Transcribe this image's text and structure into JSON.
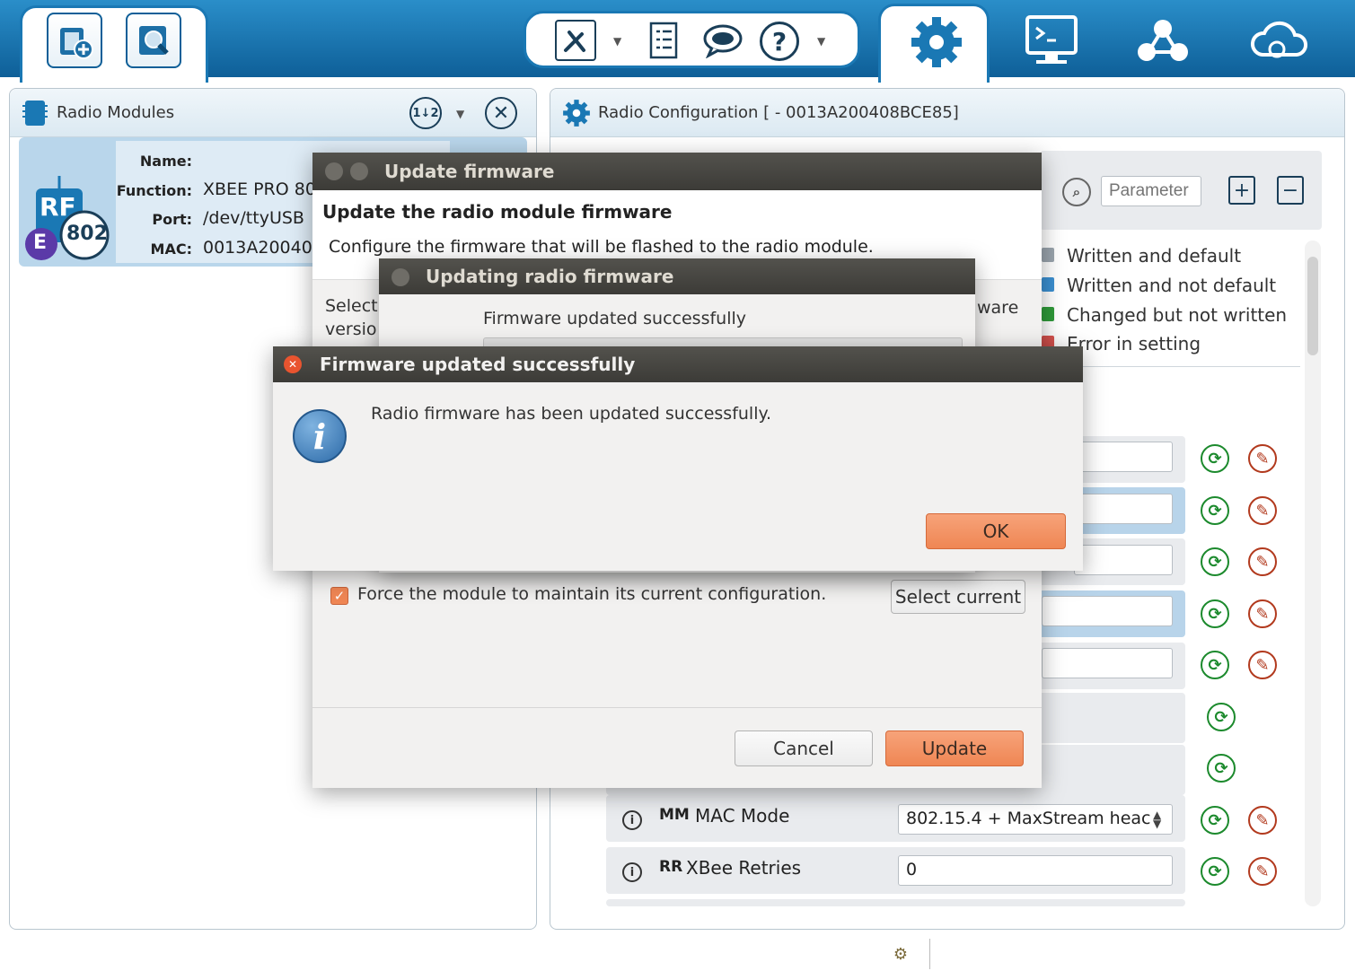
{
  "toolbar": {
    "left_buttons": [
      "add-module-icon",
      "discover-modules-icon"
    ],
    "center_icons": [
      "tools-icon",
      "console-list-icon",
      "chat-icon",
      "help-icon"
    ],
    "mode_tabs": [
      "configuration-gear-icon",
      "console-monitor-icon",
      "network-icon",
      "cloud-gear-icon"
    ]
  },
  "radio_modules": {
    "title": "Radio Modules",
    "module": {
      "name_label": "Name:",
      "function_label": "Function:",
      "function_value": "XBEE PRO 80",
      "port_label": "Port:",
      "port_value": "/dev/ttyUSB",
      "mac_label": "MAC:",
      "mac_value": "0013A20040",
      "badge_rf": "RF",
      "badge_802": "802",
      "badge_e": "E"
    }
  },
  "radio_config": {
    "title": "Radio Configuration [ - 0013A200408BCE85]",
    "search_placeholder": "Parameter",
    "legend": [
      "Written and default",
      "Written and not default",
      "Changed but not written",
      "Error in setting"
    ],
    "rows": [
      {
        "code": "MM",
        "label": "MAC Mode",
        "value": "802.15.4 + MaxStream heac",
        "type": "select"
      },
      {
        "code": "RR",
        "label": "XBee Retries",
        "value": "0",
        "type": "input"
      }
    ],
    "colors": {
      "written_default": "#9aa4ad",
      "written_not_default": "#3b8fd1",
      "changed": "#2f9a3a",
      "error": "#d9534f"
    }
  },
  "update_dialog": {
    "window_title": "Update firmware",
    "heading": "Update the radio module firmware",
    "subtitle": "Configure the firmware that will be flashed to the radio module.",
    "select_label_1": "Select",
    "select_label_2": "versio",
    "right_fragment": "ware",
    "force_checkbox_label": "Force the module to maintain its current configuration.",
    "force_checked": true,
    "select_current_label": "Select current",
    "cancel_label": "Cancel",
    "update_label": "Update"
  },
  "progress_dialog": {
    "window_title": "Updating radio firmware",
    "message": "Firmware updated successfully"
  },
  "success_dialog": {
    "window_title": "Firmware updated successfully",
    "message": "Radio firmware has been updated successfully.",
    "ok_label": "OK"
  }
}
